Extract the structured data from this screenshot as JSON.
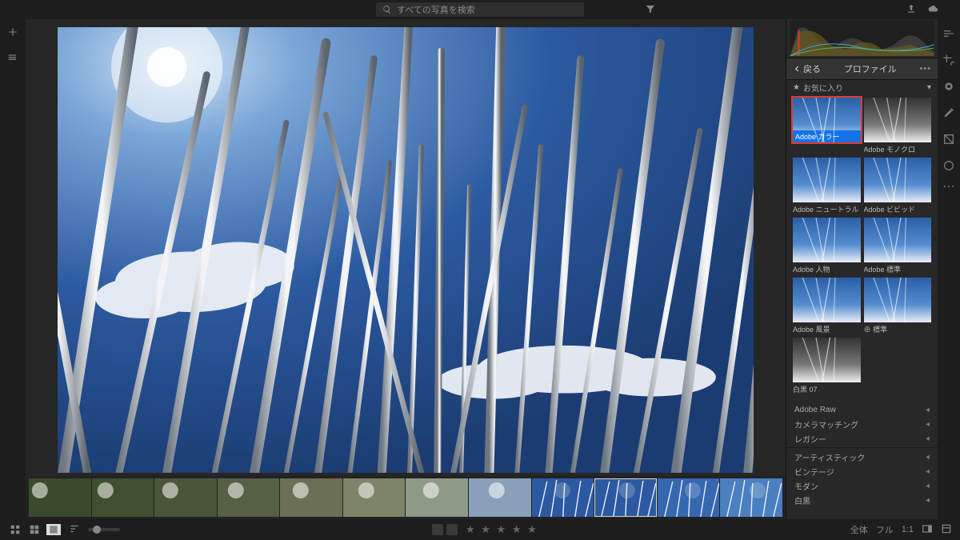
{
  "topbar": {
    "search_placeholder": "すべての写真を検索"
  },
  "panel": {
    "back_label": "戻る",
    "title": "プロファイル",
    "favorites_label": "お気に入り"
  },
  "profiles": [
    {
      "label": "Adobe カラー",
      "selected": true,
      "style": "sky"
    },
    {
      "label": "Adobe モノクロ",
      "selected": false,
      "style": "bw"
    },
    {
      "label": "Adobe ニュートラル",
      "selected": false,
      "style": "sky"
    },
    {
      "label": "Adobe ビビッド",
      "selected": false,
      "style": "sky"
    },
    {
      "label": "Adobe 人物",
      "selected": false,
      "style": "sky"
    },
    {
      "label": "Adobe 標準",
      "selected": false,
      "style": "sky"
    },
    {
      "label": "Adobe 風景",
      "selected": false,
      "style": "sky"
    },
    {
      "label": "標準",
      "selected": false,
      "style": "sky",
      "badge": true
    },
    {
      "label": "白黒 07",
      "selected": false,
      "style": "bw"
    }
  ],
  "categories_primary": [
    "Adobe Raw",
    "カメラマッチング",
    "レガシー"
  ],
  "categories_secondary": [
    "アーティスティック",
    "ビンテージ",
    "モダン",
    "白黒"
  ],
  "bottombar": {
    "zoom_fit": "全体",
    "zoom_full": "フル",
    "zoom_1to1": "1:1"
  },
  "filmstrip_count": 12,
  "filmstrip_selected_index": 9
}
